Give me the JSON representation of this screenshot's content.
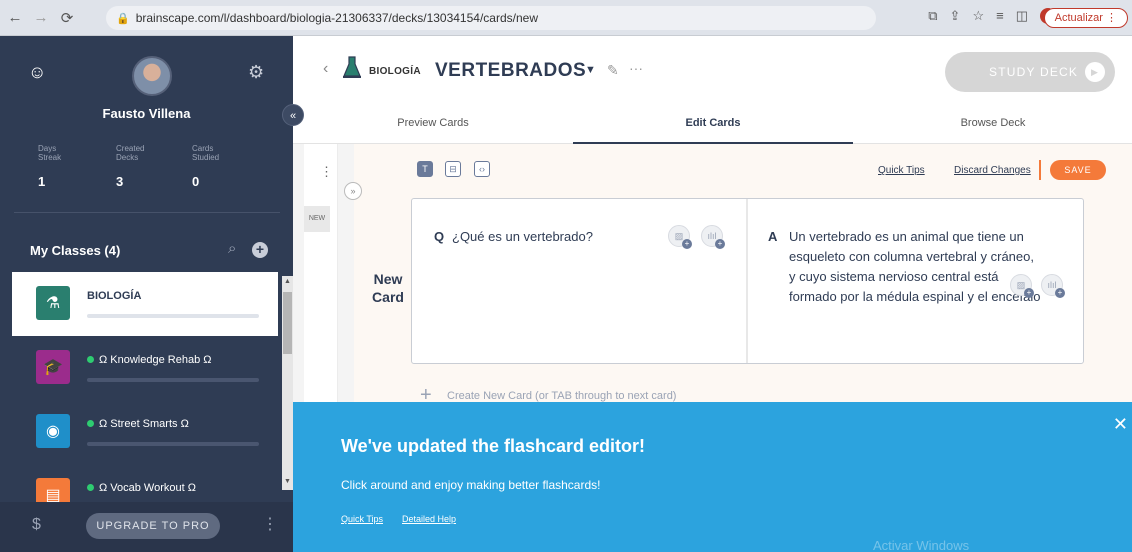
{
  "browser": {
    "url": "brainscape.com/l/dashboard/biologia-21306337/decks/13034154/cards/new",
    "update_label": "Actualizar"
  },
  "sidebar": {
    "user_name": "Fausto Villena",
    "stats": [
      {
        "label": "Days Streak",
        "value": "1"
      },
      {
        "label": "Created Decks",
        "value": "3"
      },
      {
        "label": "Cards Studied",
        "value": "0"
      }
    ],
    "classes_title": "My Classes (4)",
    "classes": [
      {
        "name": "BIOLOGÍA",
        "color": "#2a7f6f",
        "icon": "flask-icon"
      },
      {
        "name": "Ω Knowledge Rehab Ω",
        "color": "#9b2c8c",
        "icon": "graduation-cap-icon"
      },
      {
        "name": "Ω Street Smarts Ω",
        "color": "#1f8fc9",
        "icon": "brain-glasses-icon"
      },
      {
        "name": "Ω Vocab Workout Ω",
        "color": "#f47a3a",
        "icon": "book-icon"
      }
    ],
    "upgrade_label": "UPGRADE TO PRO"
  },
  "header": {
    "class_name": "BIOLOGÍA",
    "deck_title": "VERTEBRADOS",
    "study_label": "STUDY DECK"
  },
  "tabs": [
    {
      "label": "Preview Cards"
    },
    {
      "label": "Edit Cards"
    },
    {
      "label": "Browse Deck"
    }
  ],
  "editor": {
    "new_tag": "NEW",
    "quick_tips": "Quick Tips",
    "discard": "Discard Changes",
    "save": "SAVE",
    "new_card_label": "New Card",
    "question_letter": "Q",
    "question": "¿Qué es un vertebrado?",
    "answer_letter": "A",
    "answer": "Un vertebrado es un animal que tiene un esqueleto con columna vertebral y cráneo, y cuyo sistema nervioso central está formado por la médula espinal y el encéfalo",
    "create_new": "Create New Card (or TAB through to next card)"
  },
  "banner": {
    "title": "We've updated the flashcard editor!",
    "subtitle": "Click around and enjoy making better flashcards!",
    "link_quick_tips": "Quick Tips",
    "link_help": "Detailed Help",
    "watermark": "Activar Windows"
  },
  "colors": {
    "sidebar_bg": "#2f3c54",
    "accent_orange": "#f47a3a",
    "banner_blue": "#2ca3de"
  }
}
